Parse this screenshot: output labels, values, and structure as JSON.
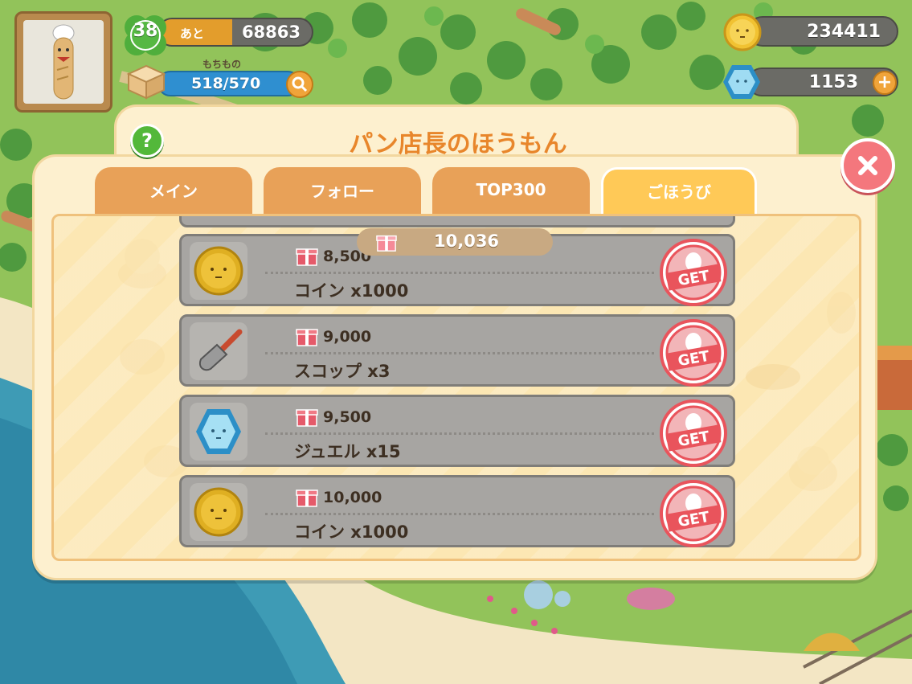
{
  "hud": {
    "level": "38",
    "exp_label": "あと",
    "exp_remaining": "68863",
    "exp_progress_percent": 48,
    "inventory_label": "もちもの",
    "inventory_value": "518/570",
    "coins": "234411",
    "jewels": "1153"
  },
  "dialog": {
    "title": "パン店長のほうもん",
    "help_label": "?",
    "tabs": [
      {
        "label": "メイン",
        "active": false
      },
      {
        "label": "フォロー",
        "active": false
      },
      {
        "label": "TOP300",
        "active": false
      },
      {
        "label": "ごほうび",
        "active": true
      }
    ],
    "current_points": "10,036",
    "rewards": [
      {
        "requirement": "8,500",
        "name": "コイン x1000",
        "icon": "coin-icon",
        "button": "GET"
      },
      {
        "requirement": "9,000",
        "name": "スコップ x3",
        "icon": "shovel-icon",
        "button": "GET"
      },
      {
        "requirement": "9,500",
        "name": "ジュエル x15",
        "icon": "jewel-icon",
        "button": "GET"
      },
      {
        "requirement": "10,000",
        "name": "コイン x1000",
        "icon": "coin-icon",
        "button": "GET"
      }
    ]
  },
  "colors": {
    "accent_orange": "#e8862b",
    "tab_active": "#ffc957",
    "get_red": "#e9545c"
  }
}
